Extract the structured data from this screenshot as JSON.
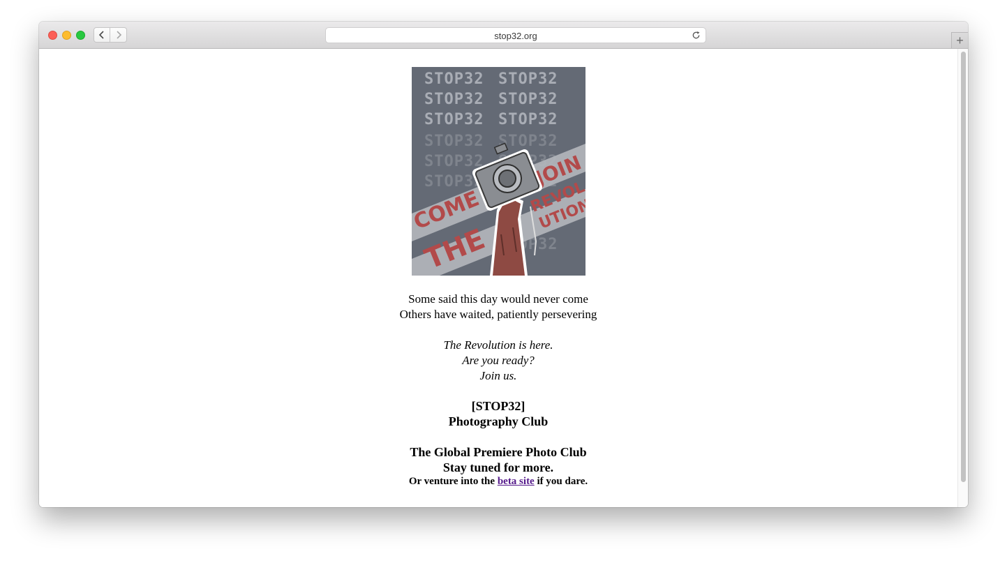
{
  "browser": {
    "url": "stop32.org",
    "new_tab_label": "+"
  },
  "poster": {
    "wordmark": "STOP32",
    "slogan_left_1": "COME",
    "slogan_left_2": "THE",
    "slogan_right_1": "JOIN",
    "slogan_right_2": "REVOL",
    "slogan_right_3": "UTION",
    "background_color": "#646a75",
    "accent_color": "#b24a4a"
  },
  "content": {
    "line1": "Some said this day would never come",
    "line2": "Others have waited, patiently persevering",
    "italic1": "The Revolution is here.",
    "italic2": "Are you ready?",
    "italic3": "Join us.",
    "club1": "[STOP32]",
    "club2": "Photography Club",
    "tag1": "The Global Premiere Photo Club",
    "tag2": "Stay tuned for more.",
    "venture_prefix": "Or venture into the ",
    "venture_link": "beta site",
    "venture_suffix": " if you dare."
  }
}
